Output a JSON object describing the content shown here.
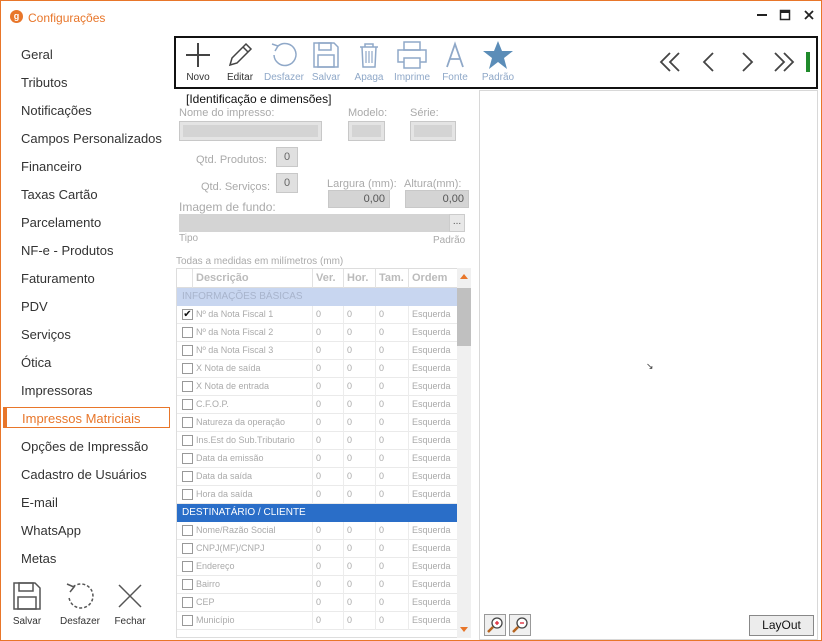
{
  "window": {
    "title": "Configurações",
    "app_icon_letter": "g"
  },
  "sidebar": {
    "items": [
      {
        "label": "Geral"
      },
      {
        "label": "Tributos"
      },
      {
        "label": "Notificações"
      },
      {
        "label": "Campos Personalizados"
      },
      {
        "label": "Financeiro"
      },
      {
        "label": "Taxas Cartão"
      },
      {
        "label": "Parcelamento"
      },
      {
        "label": "NF-e - Produtos"
      },
      {
        "label": "Faturamento"
      },
      {
        "label": "PDV"
      },
      {
        "label": "Serviços"
      },
      {
        "label": "Ótica"
      },
      {
        "label": "Impressoras"
      },
      {
        "label": "Impressos Matriciais",
        "active": true
      },
      {
        "label": "Opções de Impressão"
      },
      {
        "label": "Cadastro de Usuários"
      },
      {
        "label": "E-mail"
      },
      {
        "label": "WhatsApp"
      },
      {
        "label": "Metas"
      }
    ],
    "actions": {
      "save": "Salvar",
      "undo": "Desfazer",
      "close": "Fechar"
    }
  },
  "toolbar": {
    "new": "Novo",
    "edit": "Editar",
    "undo": "Desfazer",
    "save": "Salvar",
    "delete": "Apaga",
    "print": "Imprime",
    "font": "Fonte",
    "default": "Padrão",
    "font_glyph": "A"
  },
  "form": {
    "group_title": "[Identificação e dimensões]",
    "name_label": "Nome do impresso:",
    "model_label": "Modelo:",
    "series_label": "Série:",
    "qty_products_label": "Qtd. Produtos:",
    "qty_products_value": "0",
    "qty_services_label": "Qtd. Serviços:",
    "qty_services_value": "0",
    "width_label": "Largura (mm):",
    "width_value": "0,00",
    "height_label": "Altura(mm):",
    "height_value": "0,00",
    "bg_image_label": "Imagem de fundo:",
    "bg_button": "...",
    "type_label": "Tipo",
    "default_label": "Padrão",
    "measure_note": "Todas a medidas em milímetros (mm)"
  },
  "grid": {
    "headers": {
      "desc": "Descrição",
      "ver": "Ver.",
      "hor": "Hor.",
      "tam": "Tam.",
      "ordem": "Ordem"
    },
    "section1": "INFORMAÇÕES BÁSICAS",
    "section2": "DESTINATÁRIO / CLIENTE",
    "rows1": [
      {
        "desc": "Nº da Nota Fiscal 1",
        "checked": true
      },
      {
        "desc": "Nº da Nota Fiscal 2"
      },
      {
        "desc": "Nº da Nota Fiscal 3"
      },
      {
        "desc": "X Nota de saída"
      },
      {
        "desc": "X Nota de entrada"
      },
      {
        "desc": "C.F.O.P."
      },
      {
        "desc": "Natureza da operação"
      },
      {
        "desc": "Ins.Est do Sub.Tributario"
      },
      {
        "desc": "Data da emissão"
      },
      {
        "desc": "Data da saída"
      },
      {
        "desc": "Hora da saída"
      }
    ],
    "rows2": [
      {
        "desc": "Nome/Razão Social"
      },
      {
        "desc": "CNPJ(MF)/CNPJ"
      },
      {
        "desc": "Endereço"
      },
      {
        "desc": "Bairro"
      },
      {
        "desc": "CEP"
      },
      {
        "desc": "Município"
      }
    ],
    "cell_ver": "0",
    "cell_hor": "0",
    "cell_tam": "0",
    "cell_ordem": "Esquerda",
    "check_mark": "✔"
  },
  "canvas": {
    "layout_button": "LayOut",
    "cursor_mark": "↘"
  }
}
